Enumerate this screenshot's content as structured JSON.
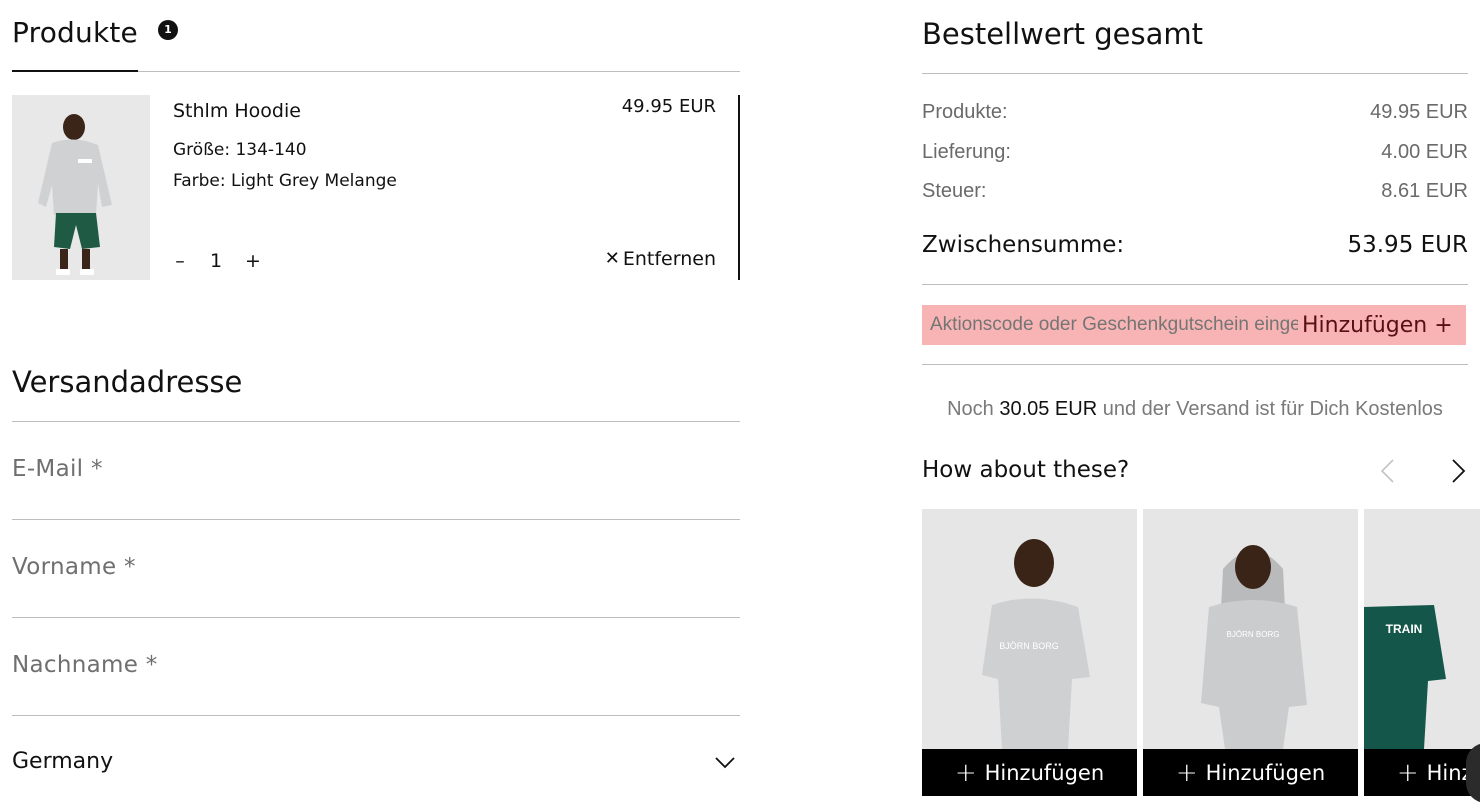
{
  "products": {
    "title": "Produkte",
    "badge_count": "1",
    "item": {
      "name": "Sthlm Hoodie",
      "price": "49.95 EUR",
      "size": "Größe: 134-140",
      "color": "Farbe: Light Grey Melange",
      "qty_minus": "–",
      "qty": "1",
      "qty_plus": "+",
      "remove_icon": "✕",
      "remove_label": "Entfernen"
    }
  },
  "address": {
    "title": "Versandadresse",
    "email_label": "E-Mail *",
    "firstname_label": "Vorname *",
    "lastname_label": "Nachname *",
    "country_value": "Germany"
  },
  "summary": {
    "title": "Bestellwert gesamt",
    "rows": [
      {
        "label": "Produkte:",
        "value": "49.95 EUR"
      },
      {
        "label": "Lieferung:",
        "value": "4.00 EUR"
      },
      {
        "label": "Steuer:",
        "value": "8.61 EUR"
      }
    ],
    "subtotal_label": "Zwischensumme:",
    "subtotal_value": "53.95 EUR",
    "promo_placeholder": "Aktionscode oder Geschenkgutschein eingeben",
    "promo_add_label": "Hinzufügen +",
    "promo_bg_color": "#f8b4b4",
    "ship_pre": "Noch",
    "ship_amount": "30.05 EUR",
    "ship_post": "und der Versand ist für Dich Kostenlos"
  },
  "suggestions": {
    "title": "How about these?",
    "prev_icon": "chevron-left-icon",
    "next_icon": "chevron-right-icon",
    "add_plus": "+",
    "add_label": "Hinzufügen",
    "card_print_1": "BJÖRN BORG",
    "card_print_3": "TRAIN"
  }
}
